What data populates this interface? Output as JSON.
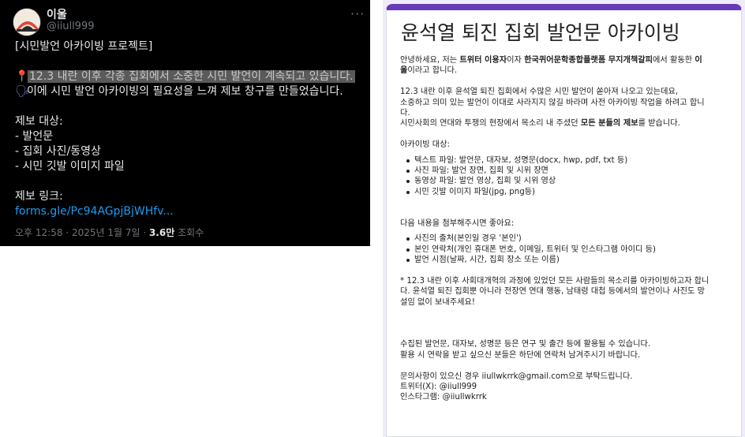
{
  "tweet": {
    "display_name": "이울",
    "handle": "@iiull999",
    "more_label": "···",
    "lines": {
      "l1": "[시민발언 아카이빙 프로젝트]",
      "l2_pin": "📍",
      "l2": "12.3 내란 이후 각종 집회에서 소중한 시민 발언이 계속되고 있습니다.",
      "l3_speak": "🗣",
      "l3": "이에 시민 발언 아카이빙의 필요성을 느껴 제보 창구를 만들었습니다.",
      "l4": "제보 대상:",
      "l5": "- 발언문",
      "l6": "- 집회 사진/동영상",
      "l7": "- 시민 깃발 이미지 파일",
      "l8": "제보 링크:"
    },
    "link_text": "forms.gle/Pc94AGpjBjWHfv...",
    "meta": {
      "time": "오후 12:58",
      "sep1": " · ",
      "date": "2025년 1월 7일",
      "sep2": " · ",
      "views_count": "3.6만",
      "views_label": " 조회수"
    }
  },
  "form": {
    "title": "윤석열 퇴진 집회 발언문 아카이빙",
    "intro": {
      "a": "안녕하세요, 저는 ",
      "b": "트위터 이용자",
      "c": "이자 ",
      "d": "한국퀴어문학종합플랫폼 무지개책갈피",
      "e": "에서 활동한 ",
      "f": "이",
      "g": "울",
      "h": "이라고 합니다."
    },
    "para2": {
      "l1": "12.3 내란 이후 윤석열 퇴진 집회에서 수많은 시민 발언이 쏟아져 나오고 있는데요,",
      "l2": "소중하고 의미 있는 발언이 이대로 사라지지 않길 바라며 사전 아카이빙 작업을 하려고 합니",
      "l3": "다.",
      "l4a": "시민사회의 연대와 투쟁의 현장에서 목소리 내 주셨던 ",
      "l4b": "모든 분들의 제보",
      "l4c": "를 받습니다."
    },
    "archive_label": "아카이빙 대상:",
    "archive_items": [
      "텍스트 파일: 발언문, 대자보, 성명문(docx, hwp, pdf, txt 등)",
      "사진 파일: 발언 장면, 집회 및 시위 장면",
      "동영상 파일: 발언 영상, 집회 및 시위 영상",
      "시민 깃발 이미지 파일(jpg, png등)"
    ],
    "attach_label": "다음 내용을 첨부해주시면 좋아요:",
    "attach_items": [
      "사진의 출처(본인일 경우 '본인')",
      "본인 연락처(개인 휴대폰 번호, 이메일, 트위터 및 인스타그램 아이디 등)",
      "발언 시점(날짜, 시간, 집회 장소 또는 이름)"
    ],
    "note": {
      "l1": "* 12.3 내란 이후 사회대개혁의 과정에 있었던 모든 사람들의 목소리를 아카이빙하고자 합니",
      "l2": "다. 윤석열 퇴진 집회뿐 아니라 전장연 연대 행동, 남태령 대첩 등에서의 발언이나 사진도 망",
      "l3": "설임 없이 보내주세요!"
    },
    "usage": {
      "l1": "수집된 발언문, 대자보, 성명문 등은 연구 및 출간 등에 활용될 수 있습니다.",
      "l2": "활용 시 연락을 받고 싶으신 분들은 하단에 연락처 남겨주시기 바랍니다."
    },
    "contact": {
      "l1": "문의사항이 있으신 경우 iiullwkrrk@gmail.com으로 부탁드립니다.",
      "l2": "트위터(X): @iiull999",
      "l3": "인스타그램: @iiullwkrrk"
    }
  },
  "colors": {
    "tweet_bg": "#000000",
    "tweet_link": "#1d9bf0",
    "form_accent": "#673ab7",
    "form_bg": "#f0ebf8"
  }
}
